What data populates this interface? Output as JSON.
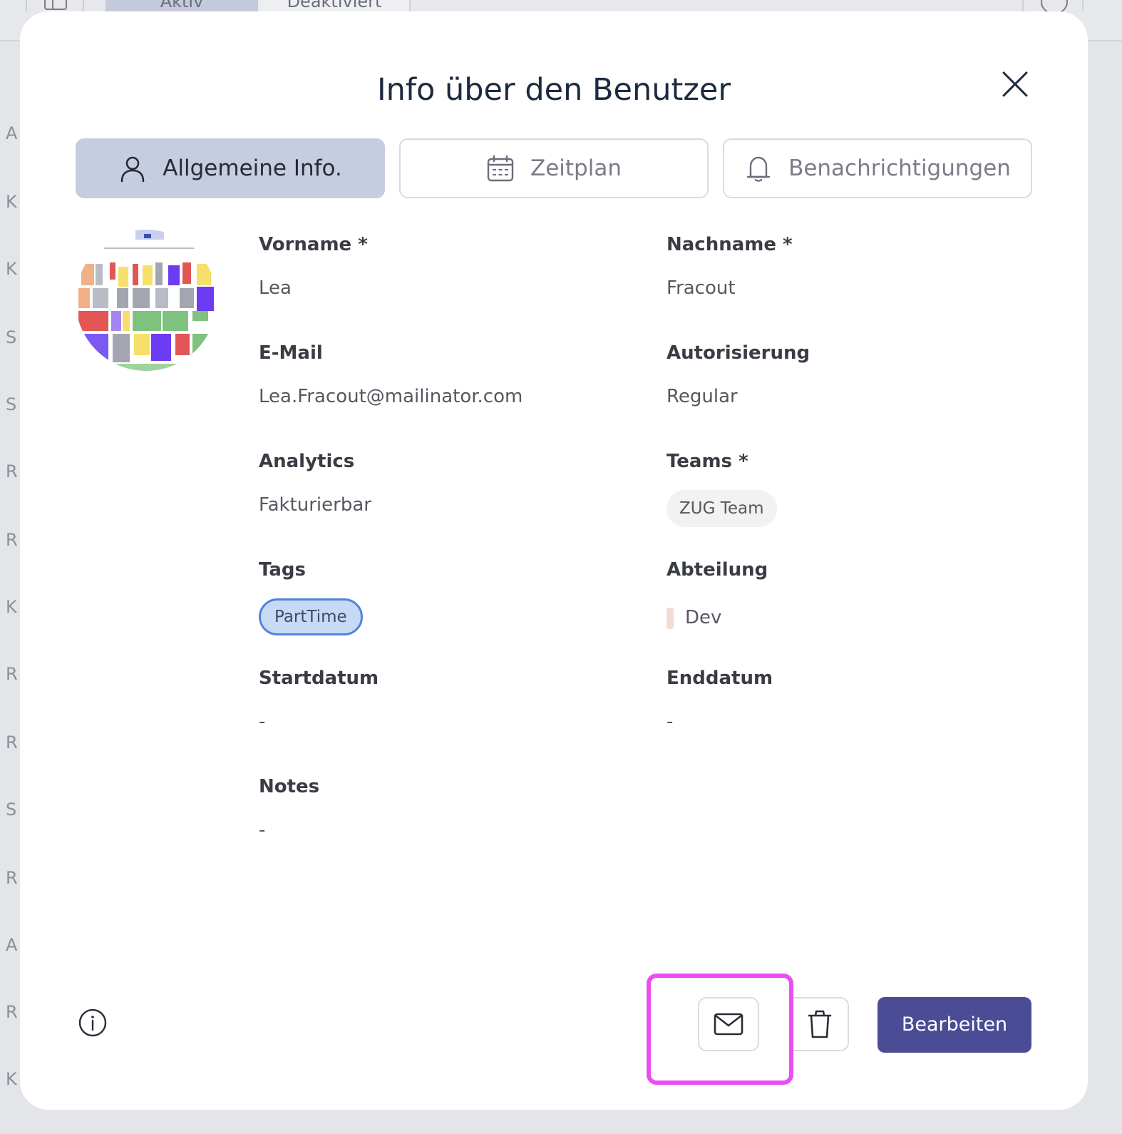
{
  "background": {
    "tabs": {
      "active": "Aktiv",
      "inactive": "Deaktiviert"
    },
    "row_letters": [
      "A",
      "K",
      "K",
      "S",
      "S",
      "R",
      "R",
      "K",
      "R",
      "R",
      "S",
      "R",
      "A",
      "R",
      "K"
    ]
  },
  "modal": {
    "title": "Info über den Benutzer",
    "tabs": [
      {
        "label": "Allgemeine Info.",
        "icon": "user-icon",
        "active": true
      },
      {
        "label": "Zeitplan",
        "icon": "calendar-icon",
        "active": false
      },
      {
        "label": "Benachrichtigungen",
        "icon": "bell-icon",
        "active": false
      }
    ],
    "fields": {
      "first_name": {
        "label": "Vorname *",
        "value": "Lea"
      },
      "last_name": {
        "label": "Nachname *",
        "value": "Fracout"
      },
      "email": {
        "label": "E-Mail",
        "value": "Lea.Fracout@mailinator.com"
      },
      "authorization": {
        "label": "Autorisierung",
        "value": "Regular"
      },
      "analytics": {
        "label": "Analytics",
        "value": "Fakturierbar"
      },
      "teams": {
        "label": "Teams *",
        "values": [
          "ZUG Team"
        ]
      },
      "tags": {
        "label": "Tags",
        "values": [
          "PartTime"
        ]
      },
      "department": {
        "label": "Abteilung",
        "value": "Dev",
        "color": "#f1ddd3"
      },
      "start_date": {
        "label": "Startdatum",
        "value": "-"
      },
      "end_date": {
        "label": "Enddatum",
        "value": "-"
      },
      "notes": {
        "label": "Notes",
        "value": "-"
      }
    },
    "footer": {
      "edit_label": "Bearbeiten",
      "info_icon": "info-icon",
      "mail_icon": "mail-icon",
      "delete_icon": "trash-icon"
    }
  },
  "colors": {
    "accent": "#4a4c96",
    "active_tab": "#c7cde0",
    "tag_fill": "#c6d9f5",
    "tag_border": "#4f84dc",
    "highlight": "#ea4ef0"
  }
}
